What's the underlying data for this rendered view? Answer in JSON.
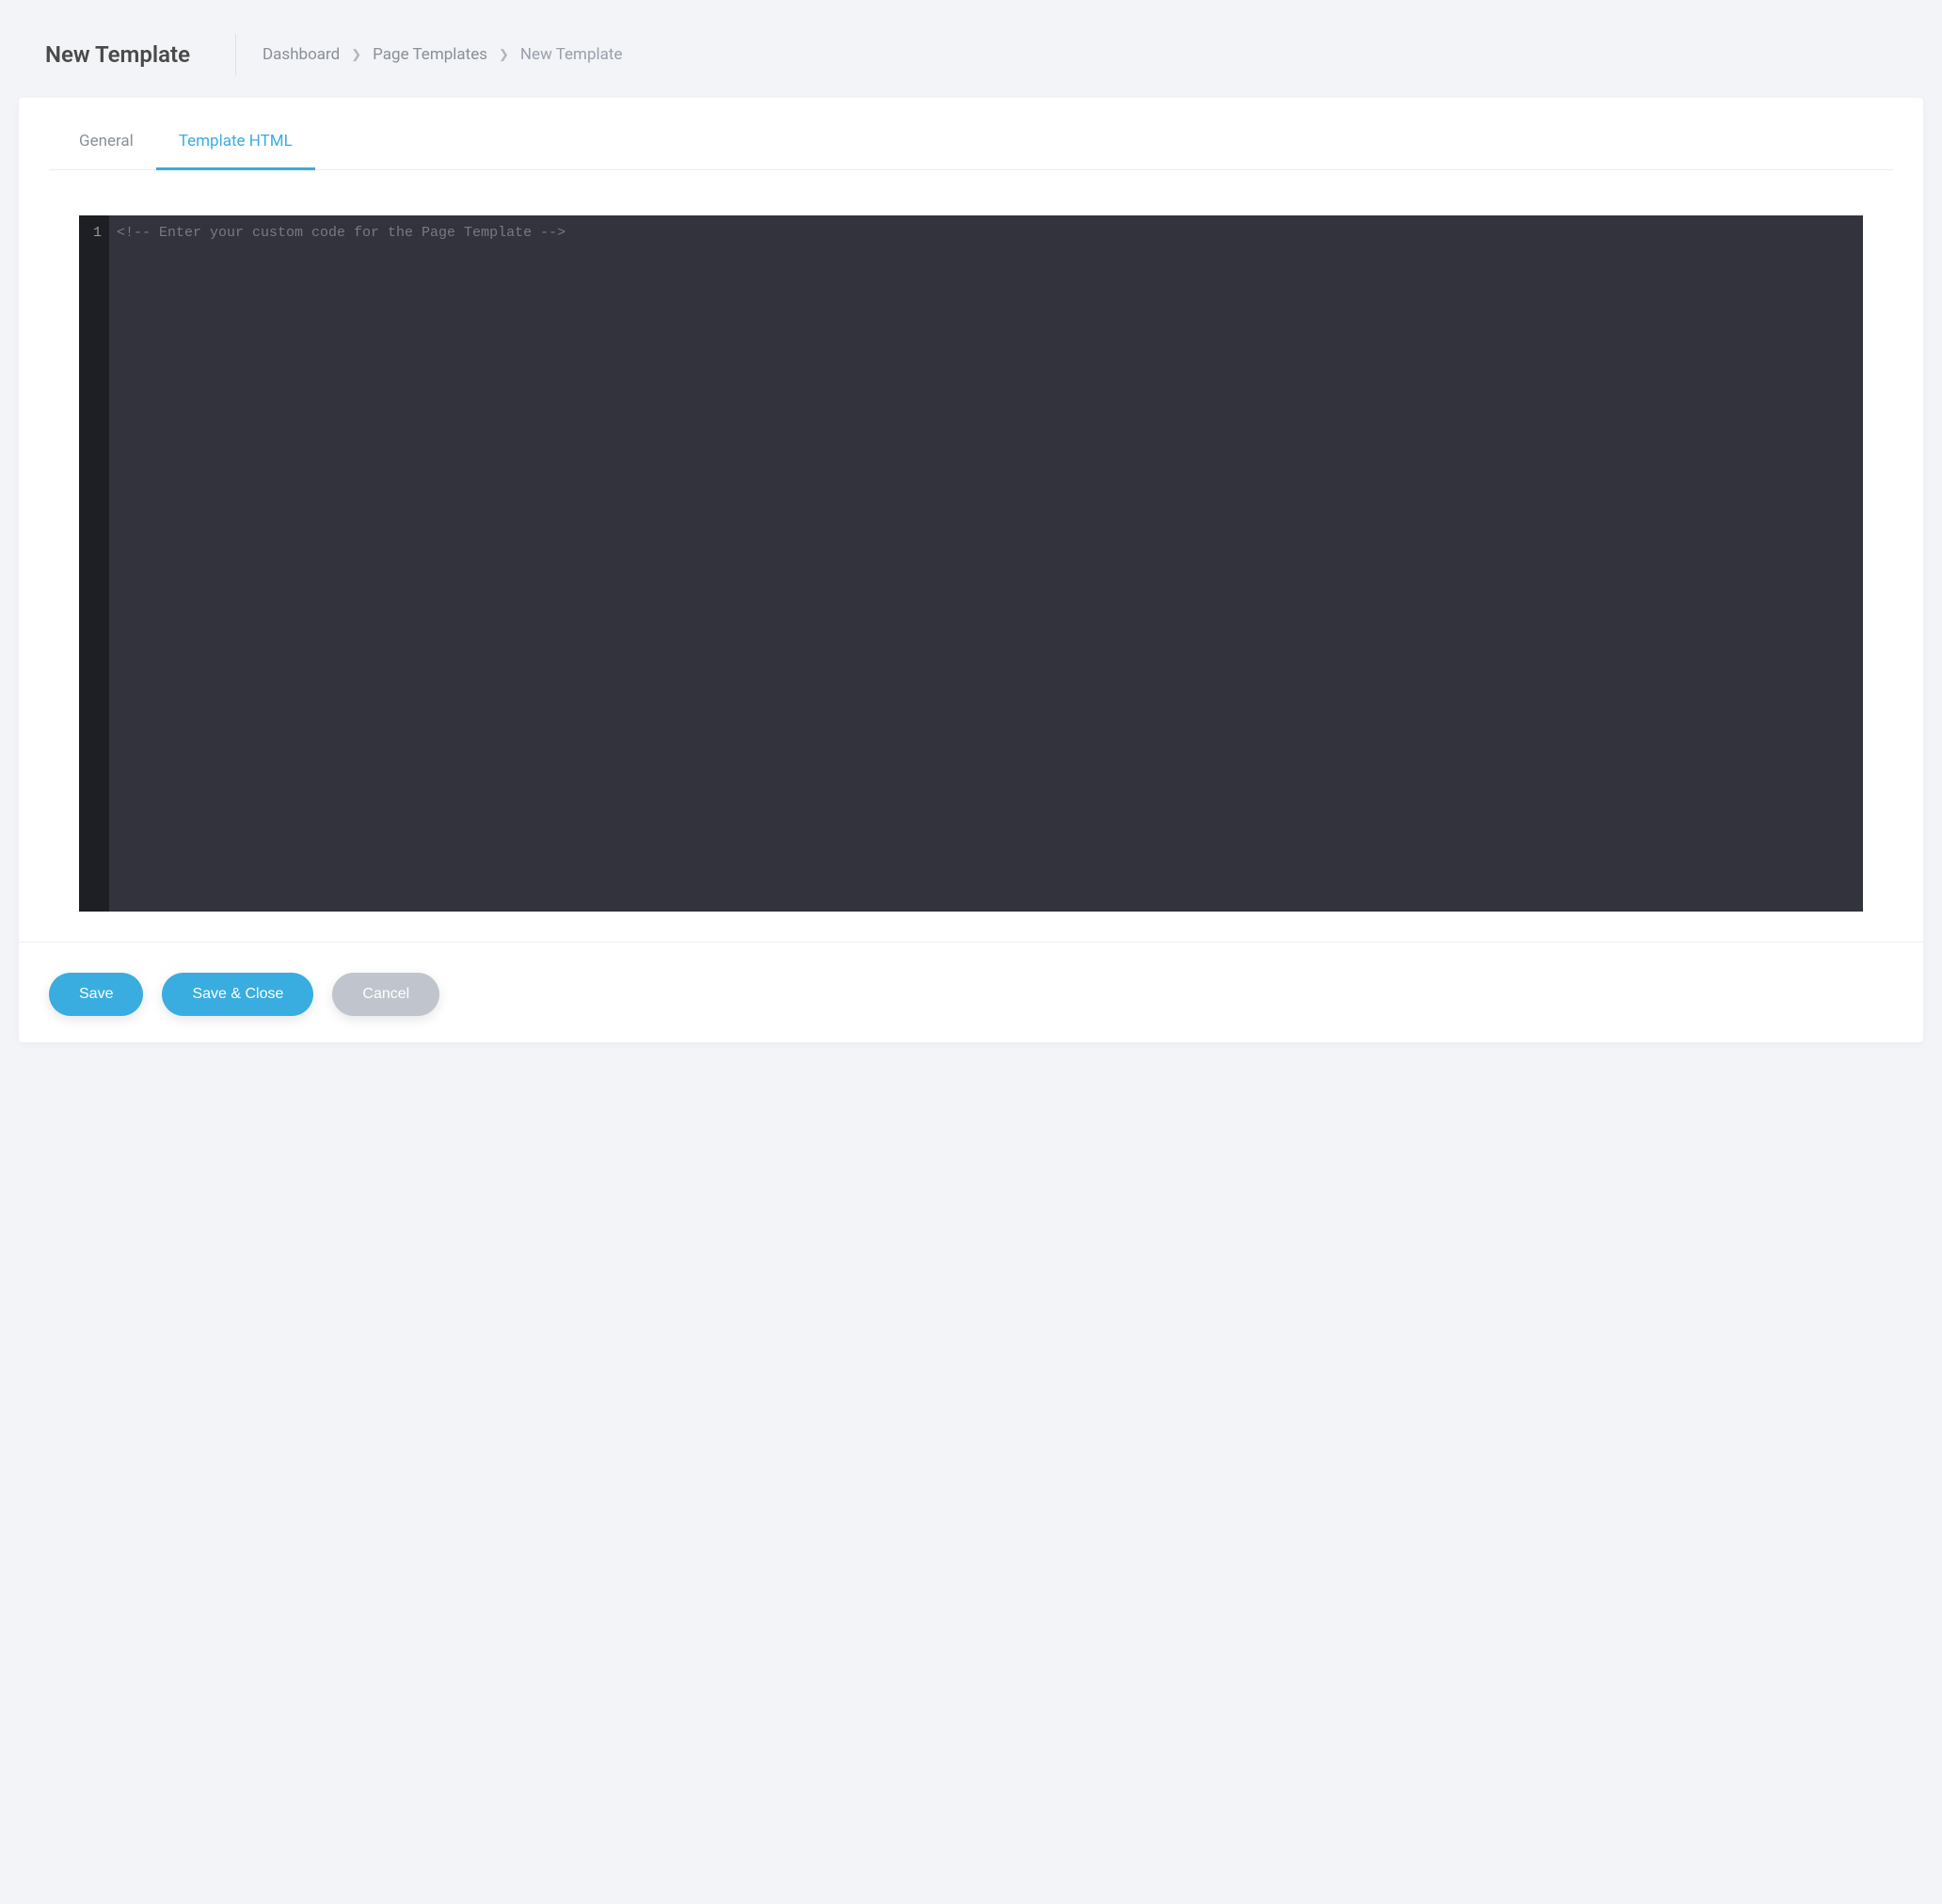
{
  "header": {
    "title": "New Template",
    "breadcrumb": {
      "dashboard": "Dashboard",
      "page_templates": "Page Templates",
      "current": "New Template"
    }
  },
  "tabs": {
    "general": "General",
    "template_html": "Template HTML"
  },
  "editor": {
    "line_number": "1",
    "content": "<!-- Enter your custom code for the Page Template -->"
  },
  "footer": {
    "save": "Save",
    "save_close": "Save & Close",
    "cancel": "Cancel"
  }
}
